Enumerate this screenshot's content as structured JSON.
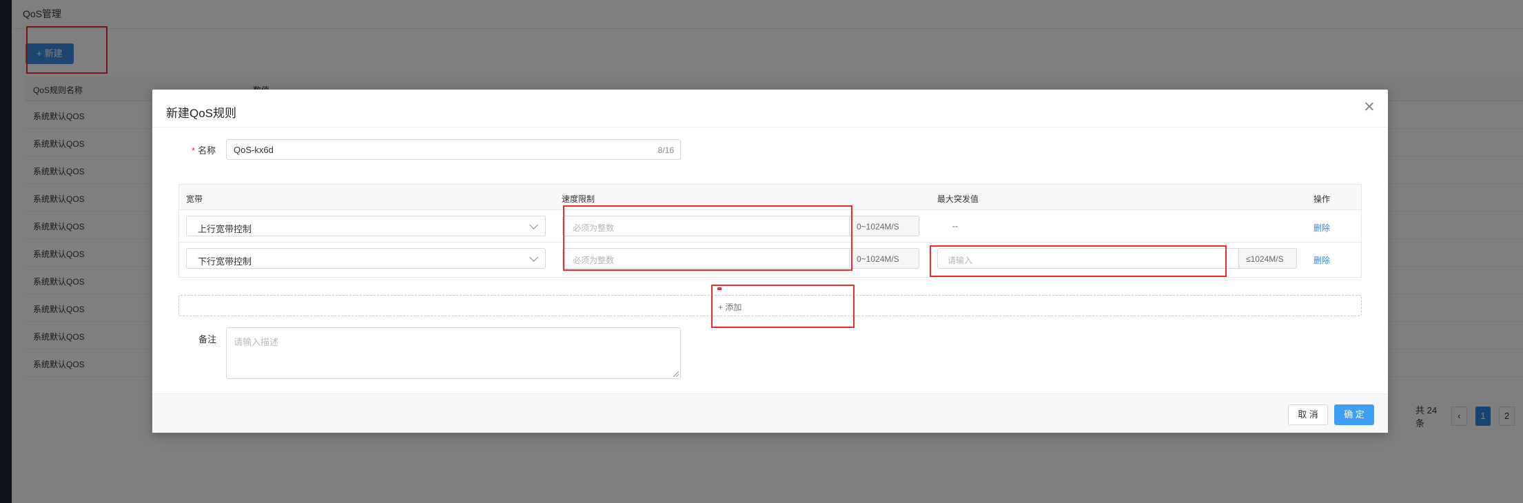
{
  "page": {
    "title": "QoS管理",
    "new_button": "新建",
    "table": {
      "columns": [
        "QoS规则名称",
        "数值"
      ],
      "rows": [
        "系统默认QOS",
        "系统默认QOS",
        "系统默认QOS",
        "系统默认QOS",
        "系统默认QOS",
        "系统默认QOS",
        "系统默认QOS",
        "系统默认QOS",
        "系统默认QOS",
        "系统默认QOS"
      ]
    },
    "pagination": {
      "total": "共 24 条",
      "prev": "‹",
      "pages": [
        "1",
        "2"
      ],
      "current": "1"
    }
  },
  "modal": {
    "title": "新建QoS规则",
    "name_label": "名称",
    "name_value": "QoS-kx6d",
    "name_count": "8/16",
    "rules": {
      "columns": [
        "宽带",
        "速度限制",
        "最大突发值",
        "操作"
      ],
      "rows": [
        {
          "bandwidth": "上行宽带控制",
          "speed_placeholder": "必须为整数",
          "speed_unit": "0~1024M/S",
          "burst": "--",
          "action": "删除"
        },
        {
          "bandwidth": "下行宽带控制",
          "speed_placeholder": "必须为整数",
          "speed_unit": "0~1024M/S",
          "burst_placeholder": "请输入",
          "burst_unit": "≤1024M/S",
          "action": "删除"
        }
      ]
    },
    "add_label": "+ 添加",
    "remark_label": "备注",
    "remark_placeholder": "请输入描述",
    "cancel": "取 消",
    "ok": "确 定"
  },
  "colors": {
    "primary": "#3f9ff5",
    "annotation": "#f02a2a",
    "link": "#2e8ae6"
  }
}
